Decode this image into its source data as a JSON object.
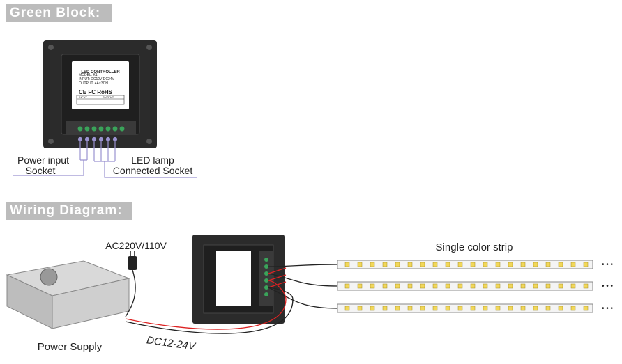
{
  "sections": {
    "green_block": "Green Block:",
    "wiring": "Wiring Diagram:"
  },
  "controller_label": {
    "title": "LED CONTROLLER",
    "model": "MODEL:  K1",
    "input": "INPUT:   DC12V-DC24V",
    "output": "OUTPUT:  4A×3CH",
    "certs": "CE  FC  RoHS",
    "table_input": "INPUT",
    "table_output": "OUTPUT"
  },
  "callouts": {
    "power_line1": "Power input",
    "power_line2": "Socket",
    "led_line1": "LED lamp",
    "led_line2": "Connected Socket"
  },
  "wiring": {
    "ac_label": "AC220V/110V",
    "strip_label": "Single color strip",
    "psu_label": "Power Supply",
    "dc_label": "DC12-24V",
    "ellipsis": "• • •"
  },
  "colors": {
    "panel": "#2b2b2b",
    "terminal": "#3aa35a",
    "callout_line": "#9a92d0",
    "header_bg": "#bcbcbc"
  }
}
